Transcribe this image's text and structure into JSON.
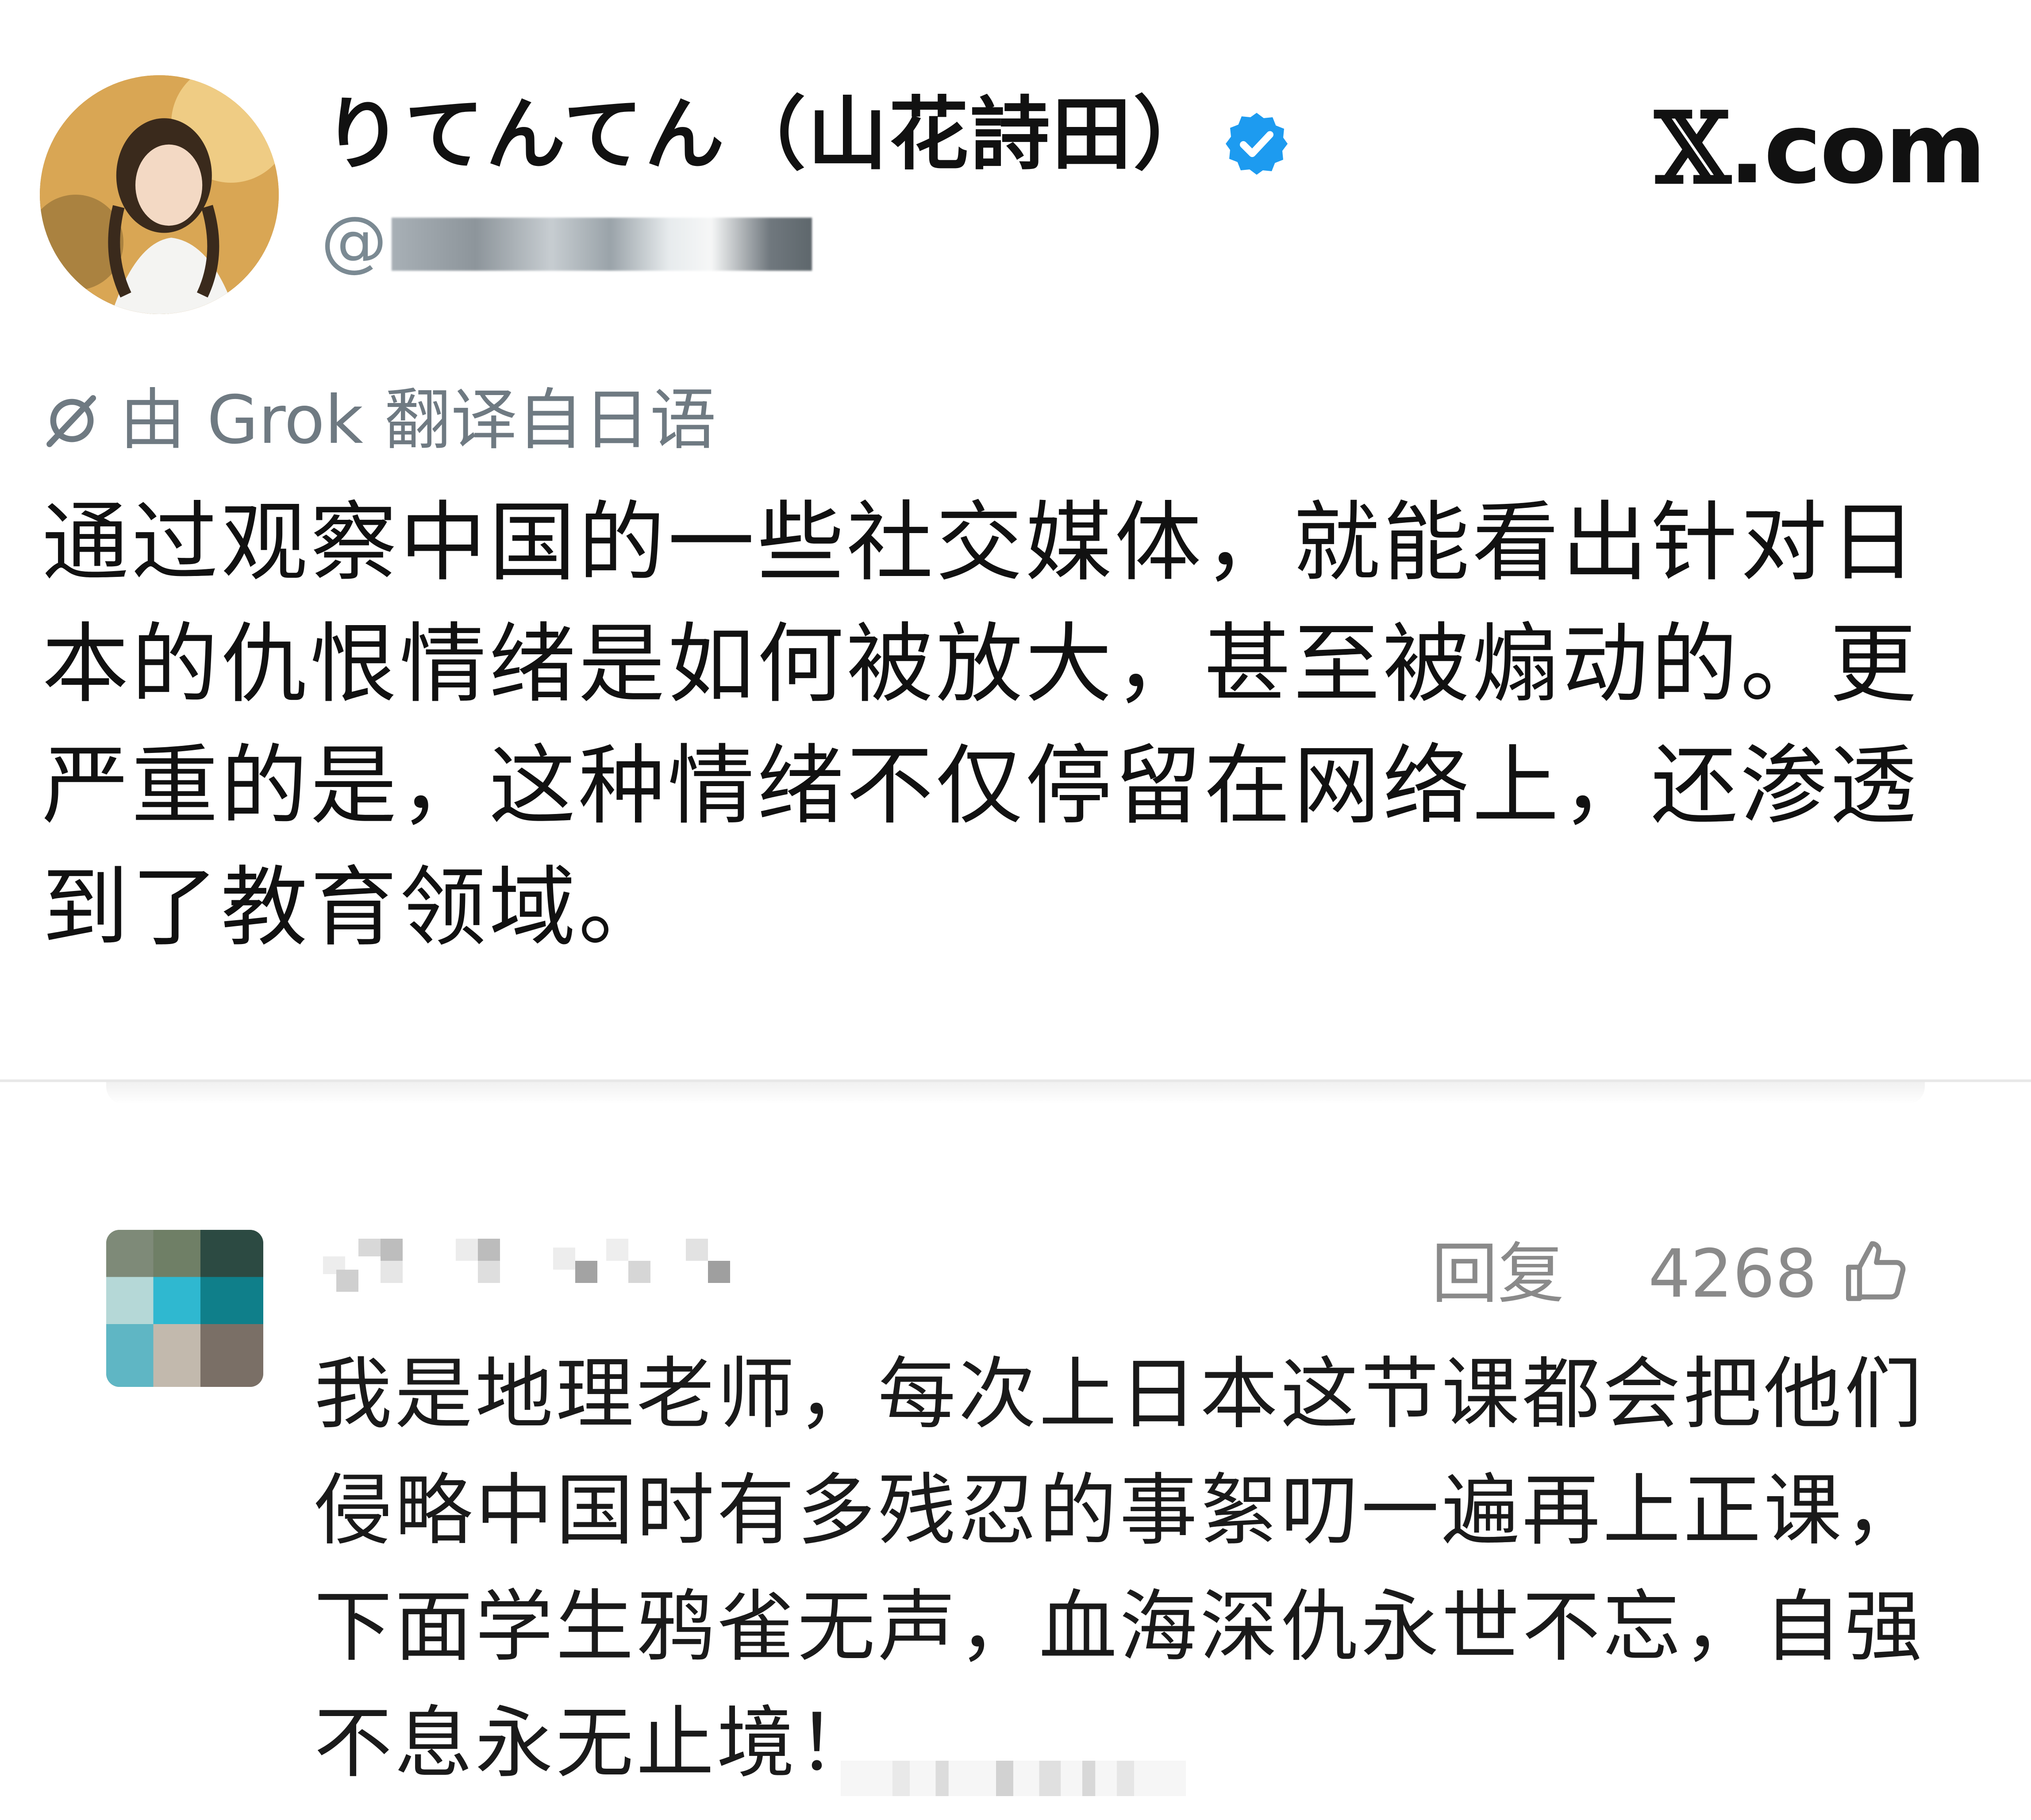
{
  "post": {
    "display_name": "りてんてん（山花詩田）",
    "handle_prefix": "@",
    "verified_icon": "verified-badge-icon",
    "site_logo_x": "𝕏",
    "site_logo_domain": ".com",
    "translation_notice": "由 Grok 翻译自日语",
    "body": "通过观察中国的一些社交媒体，就能看出针对日本的仇恨情绪是如何被放大，甚至被煽动的。更严重的是，这种情绪不仅停留在网络上，还渗透到了教育领域。"
  },
  "comment": {
    "reply_label": "回复",
    "like_count": "4268",
    "like_icon": "thumbs-up-icon",
    "text": "我是地理老师，每次上日本这节课都会把他们侵略中国时有多残忍的事絮叨一遍再上正课，下面学生鸦雀无声，血海深仇永世不忘，自强不息永无止境！"
  },
  "colors": {
    "verified_blue": "#1d9bf0",
    "muted_gray": "#8a8a8a",
    "text_dark": "#111111"
  }
}
